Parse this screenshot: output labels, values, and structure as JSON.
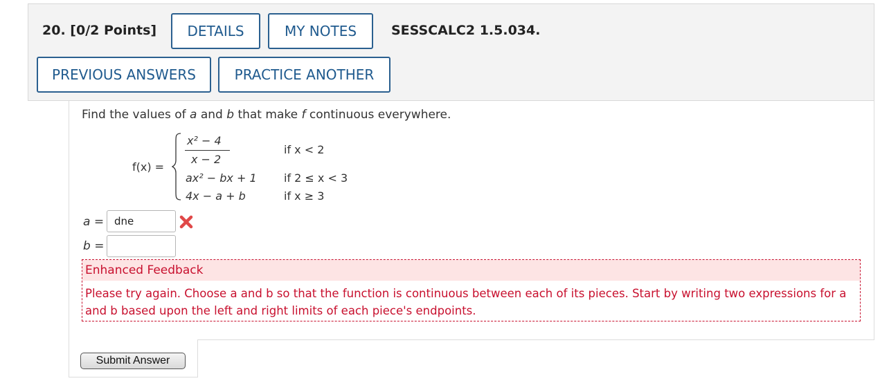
{
  "question": {
    "number": "20.",
    "points": "[0/2 Points]",
    "code": "SESSCALC2 1.5.034."
  },
  "buttons": {
    "details": "DETAILS",
    "my_notes": "MY NOTES",
    "previous_answers": "PREVIOUS ANSWERS",
    "practice_another": "PRACTICE ANOTHER",
    "submit": "Submit Answer"
  },
  "prompt": {
    "lead": "Find the values of ",
    "var_a": "a",
    "and": " and ",
    "var_b": "b",
    "mid": " that make ",
    "var_f": "f",
    "tail": " continuous everywhere."
  },
  "function": {
    "lhs": "f(x)  =",
    "piece1_numerator": "x² − 4",
    "piece1_denominator": "x − 2",
    "piece1_condition": "if x < 2",
    "piece2_expr": "ax² − bx + 1",
    "piece2_condition": "if 2 ≤ x < 3",
    "piece3_expr": "4x − a + b",
    "piece3_condition": "if x ≥ 3"
  },
  "answers": {
    "a_label": "a =",
    "a_value": "dne",
    "a_status": "incorrect",
    "b_label": "b =",
    "b_value": ""
  },
  "feedback": {
    "title": "Enhanced Feedback",
    "body": "Please try again. Choose a and b so that the function is continuous between each of its pieces. Start by writing two expressions for a and b based upon the left and right limits of each piece's endpoints."
  },
  "colors": {
    "accent": "#1f5a8e",
    "error": "#c8102e",
    "feedback_bg": "#fde4e4",
    "panel_bg": "#f3f3f3"
  },
  "icons": {
    "incorrect": "x-mark-icon"
  }
}
